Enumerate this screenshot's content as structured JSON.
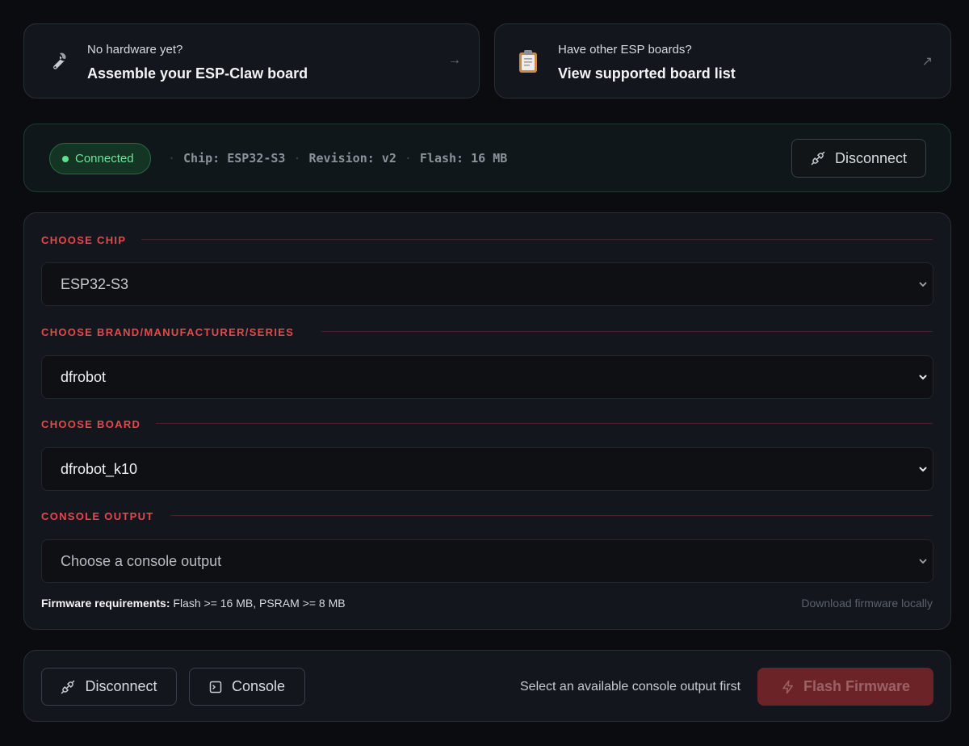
{
  "links": [
    {
      "icon": "wrench-icon",
      "subtitle": "No hardware yet?",
      "title": "Assemble your ESP-Claw board",
      "arrow": "→"
    },
    {
      "icon": "clipboard-icon",
      "subtitle": "Have other ESP boards?",
      "title": "View supported board list",
      "arrow": "↗"
    }
  ],
  "connection": {
    "status": "Connected",
    "status_color": "#6ee39b",
    "chip": "Chip: ESP32-S3",
    "revision": "Revision: v2",
    "flash": "Flash: 16 MB",
    "disconnect_label": "Disconnect"
  },
  "config": {
    "chip": {
      "label": "CHOOSE CHIP",
      "value": "ESP32-S3"
    },
    "brand": {
      "label": "CHOOSE BRAND/MANUFACTURER/SERIES",
      "value": "dfrobot"
    },
    "board": {
      "label": "CHOOSE BOARD",
      "value": "dfrobot_k10"
    },
    "console": {
      "label": "CONSOLE OUTPUT",
      "placeholder": "Choose a console output"
    },
    "requirements_label": "Firmware requirements:",
    "requirements_value": " Flash >= 16 MB, PSRAM >= 8 MB",
    "download_label": "Download firmware locally"
  },
  "actions": {
    "disconnect_label": "Disconnect",
    "console_label": "Console",
    "hint": "Select an available console output first",
    "flash_label": "Flash Firmware"
  },
  "colors": {
    "accent_red": "#e5484d",
    "flash_button_bg": "#6b2327",
    "background": "#0a0c10"
  }
}
